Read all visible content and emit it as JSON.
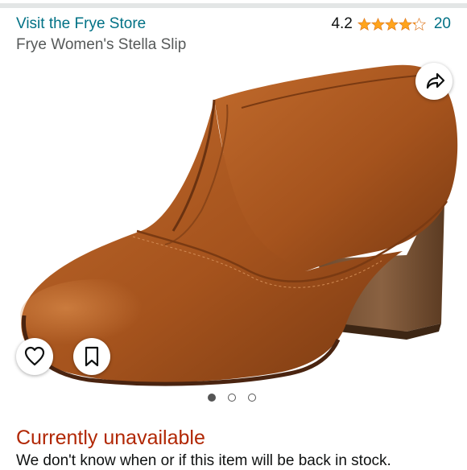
{
  "header": {
    "store_link": "Visit the Frye Store",
    "product_title": "Frye Women's Stella Slip",
    "rating_value": "4.2",
    "rating_stars": 4.2,
    "rating_count": "20"
  },
  "gallery": {
    "image_count": 3,
    "active_index": 0,
    "image_description": "Cognac brown leather slip-on bootie with stacked wooden block heel",
    "icons": {
      "share": "share-arrow-icon",
      "favorite": "heart-icon",
      "save": "bookmark-icon"
    }
  },
  "availability": {
    "status": "Currently unavailable",
    "note": "We don't know when or if this item will be back in stock."
  },
  "colors": {
    "link": "#007185",
    "star": "#ffa41c",
    "unavailable": "#b12704",
    "leather": "#a0521f"
  }
}
